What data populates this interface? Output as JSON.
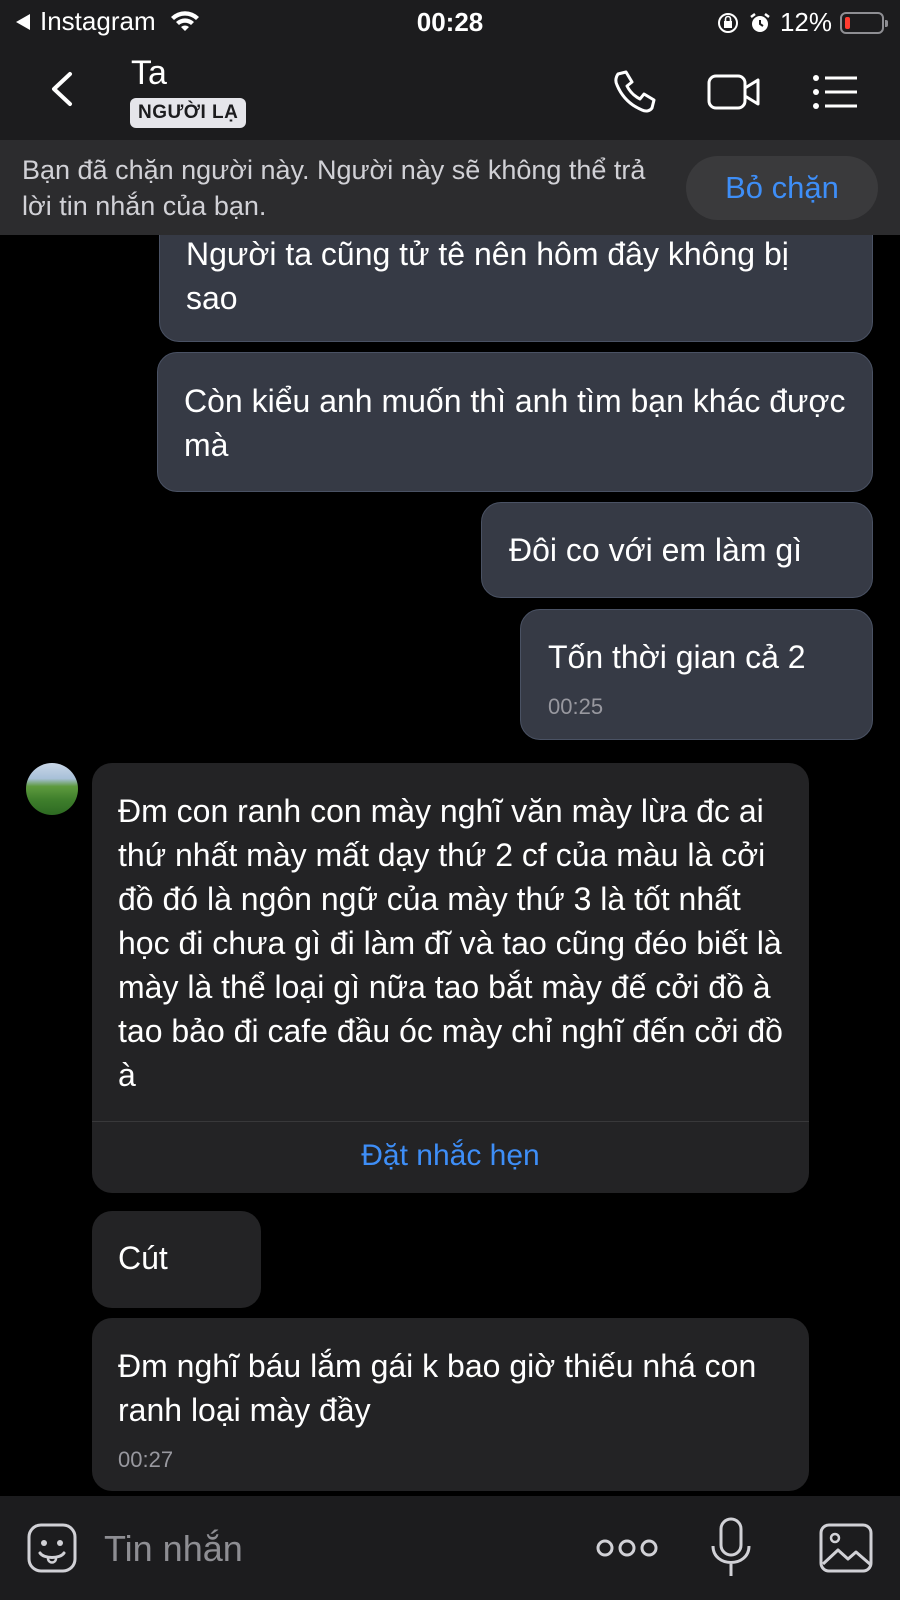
{
  "status_bar": {
    "back_app": "Instagram",
    "time": "00:28",
    "battery": "12%",
    "battery_level": 0.12,
    "icons": [
      "wifi-icon",
      "rotation-lock-icon",
      "alarm-icon",
      "battery-icon"
    ]
  },
  "header": {
    "title": "Ta",
    "badge": "NGƯỜI LẠ",
    "icons": [
      "back-chevron-icon",
      "phone-icon",
      "video-icon",
      "menu-icon"
    ]
  },
  "banner": {
    "text": "Bạn đã chặn người này. Người này sẽ không thể trả lời tin nhắn của bạn.",
    "button": "Bỏ chặn"
  },
  "messages": [
    {
      "direction": "sent",
      "text": "Người ta cũng tử tê nên hôm đây không bị sao"
    },
    {
      "direction": "sent",
      "text": "Còn kiểu anh muốn thì anh tìm bạn khác được mà"
    },
    {
      "direction": "sent",
      "text": "Đôi co với em làm gì"
    },
    {
      "direction": "sent",
      "text": "Tốn thời gian cả 2",
      "time": "00:25"
    },
    {
      "direction": "received",
      "text": "Đm con ranh con mày nghĩ văn mày lừa đc ai thứ nhất mày mất dạy thứ 2 cf của màu là cởi đồ đó là ngôn ngữ của mày thứ 3 là tốt nhất học đi chưa gì đi làm đĩ và tao cũng đéo biết là mày là thể loại gì nữa tao bắt mày đế cởi đồ à tao bảo đi cafe đầu óc mày chỉ nghĩ đến cởi đồ à",
      "action": "Đặt nhắc hẹn"
    },
    {
      "direction": "received",
      "text": "Cút"
    },
    {
      "direction": "received",
      "text": "Đm nghĩ báu lắm gái k bao giờ thiếu nhá con ranh loại mày đầy",
      "time": "00:27"
    }
  ],
  "composer": {
    "placeholder": "Tin nhắn",
    "icons": [
      "emoji-icon",
      "more-icon",
      "microphone-icon",
      "image-icon"
    ]
  },
  "colors": {
    "accent": "#3e8ef7",
    "sent_bubble": "#363a45",
    "received_bubble": "#232325",
    "battery_low": "#ff3b30"
  }
}
